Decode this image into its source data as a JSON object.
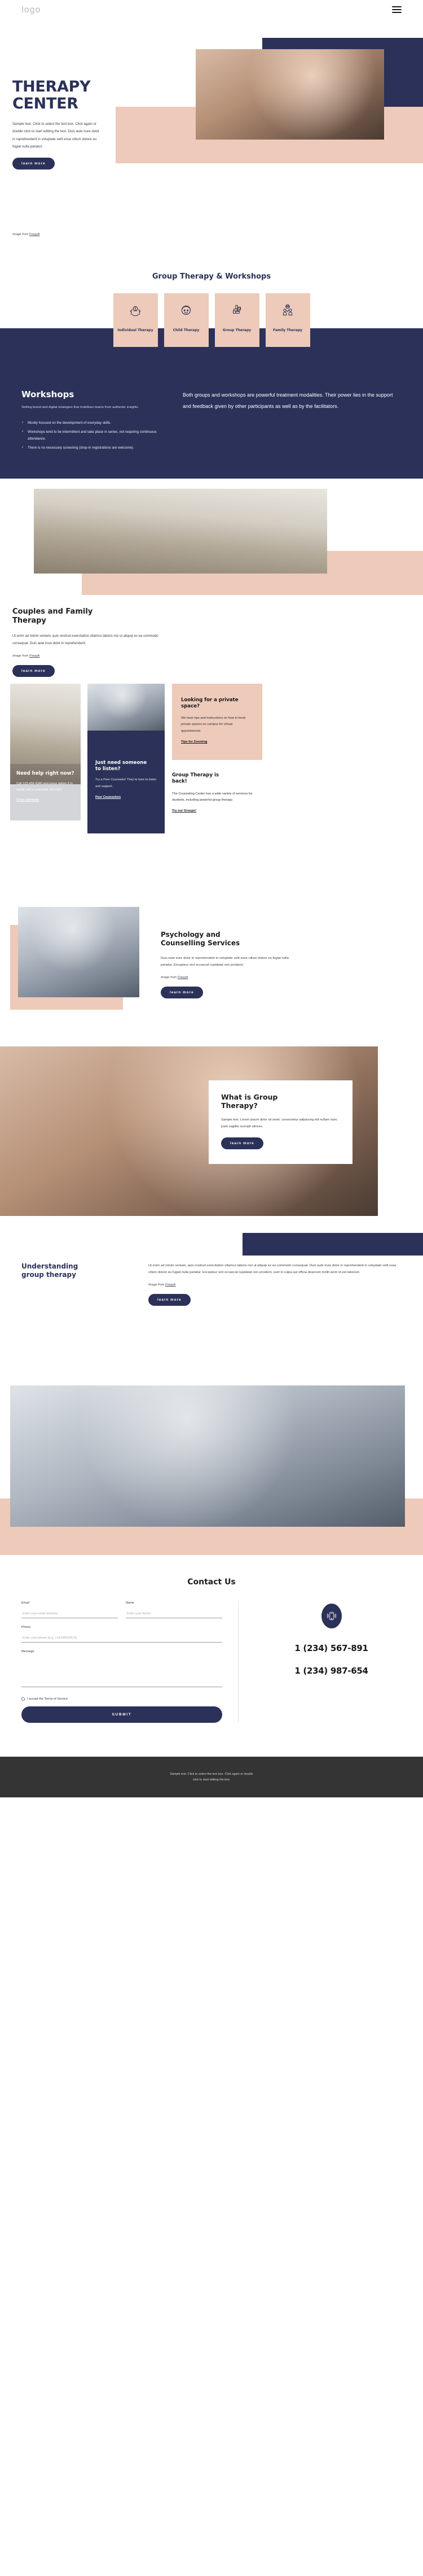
{
  "header": {
    "logo": "logo",
    "menu_icon": "hamburger-menu-icon"
  },
  "hero": {
    "title_line1": "THERAPY",
    "title_line2": "CENTER",
    "body": "Sample text. Click to select the text box. Click again or double click to start editing the text. Duis aute irure dolor in reprehenderit in voluptate velit esse cillum dolore eu fugiat nulla pariatur.",
    "button": "learn more",
    "credit_prefix": "Image from ",
    "credit_link": "Freepik"
  },
  "services": {
    "title": "Group Therapy & Workshops",
    "cards": [
      {
        "label": "Individual Therapy",
        "icon": "hands-brain-icon"
      },
      {
        "label": "Child Therapy",
        "icon": "child-face-icon"
      },
      {
        "label": "Group Therapy",
        "icon": "hands-together-icon"
      },
      {
        "label": "Family Therapy",
        "icon": "family-group-icon"
      }
    ]
  },
  "workshops": {
    "heading": "Workshops",
    "subtitle": "Setting brand and digital strategies that mobilises teams from authentic insights.",
    "bullets": [
      "Mostly focused on the development of everyday skills.",
      "Workshops tend to be intermittent and take place in series, not requiring continuous attendance.",
      "There is no necessary screening (drop-in registrations are welcome)."
    ],
    "right_text": "Both groups and workshops are powerful treatment modalities. Their power lies in the support and feedback given by other participants as well as by the facilitators."
  },
  "couples": {
    "heading_line1": "Couples and Family",
    "heading_line2": "Therapy",
    "body": "Ut enim ad minim veniam, quis nostrud exercitation ullamco laboris nisi ut aliquip ex ea commodo consequat. Duis aute irure dolor in reprehenderit.",
    "credit_prefix": "Image from ",
    "credit_link": "Freepik",
    "button": "learn more"
  },
  "tri": {
    "crisis": {
      "heading": "Need help right now?",
      "body": "Call 123-456-4340 and press option 2 to speak with a counselor 24/7/365",
      "link": "Crisis Services"
    },
    "listen": {
      "heading_line1": "Just need someone",
      "heading_line2": "to listen?",
      "body": "Try a Peer Counselor! They’re here to listen and support.",
      "link": "Peer Counselors"
    },
    "private": {
      "heading_line1": "Looking for a private",
      "heading_line2": "space?",
      "body": "We have tips and instructions on how to book private spaces on campus for virtual appointments.",
      "link": "Tips for Zooming"
    },
    "groupback": {
      "heading_line1": "Group Therapy is",
      "heading_line2": "back!",
      "body": "The Counseling Center has a wide variety of services for students, including powerful group therapy.",
      "link": "Try our Groups!"
    }
  },
  "psychology": {
    "heading_line1": "Psychology and",
    "heading_line2": "Counselling Services",
    "body": "Duis aute irure dolor in reprehenderit in voluptate velit esse cillum dolore eu fugiat nulla pariatur. Excepteur sint occaecat cupidatat non proident.",
    "credit_prefix": "Image from ",
    "credit_link": "Freepik",
    "button": "learn more"
  },
  "whatis": {
    "heading_line1": "What is Group",
    "heading_line2": "Therapy?",
    "body": "Sample text. Lorem ipsum dolor sit amet, consectetur adipiscing elit nullam nunc justo sagittis suscipit ultrices.",
    "button": "learn more"
  },
  "understanding": {
    "heading_line1": "Understanding",
    "heading_line2": "group therapy",
    "body": "Ut enim ad minim veniam, quis nostrud exercitation ullamco laboris nisi ut aliquip ex ea commodo consequat. Duis aute irure dolor in reprehenderit in voluptate velit esse cillum dolore eu fugiat nulla pariatur. Excepteur sint occaecat cupidatat non proident, sunt in culpa qui officia deserunt mollit anim id est laborum.",
    "credit_prefix": "Image from ",
    "credit_link": "Freepik",
    "button": "learn more"
  },
  "contact": {
    "heading": "Contact Us",
    "fields": {
      "email_label": "Email",
      "email_placeholder": "Enter your email address",
      "name_label": "Name",
      "name_placeholder": "Enter your Name",
      "phone_label": "Phone",
      "phone_placeholder": "Enter your phone (e.g. +14155552675)",
      "message_label": "Message"
    },
    "terms": "I accept the Terms of Service",
    "submit": "SUBMIT",
    "phone_icon": "mobile-ringing-icon",
    "phone1": "1 (234) 567-891",
    "phone2": "1 (234) 987-654"
  },
  "footer": {
    "line1": "Sample text. Click to select the text box. Click again or double",
    "line2": "click to start editing the text."
  },
  "colors": {
    "navy": "#2b3158",
    "peach": "#edcab9",
    "footer": "#343434"
  }
}
